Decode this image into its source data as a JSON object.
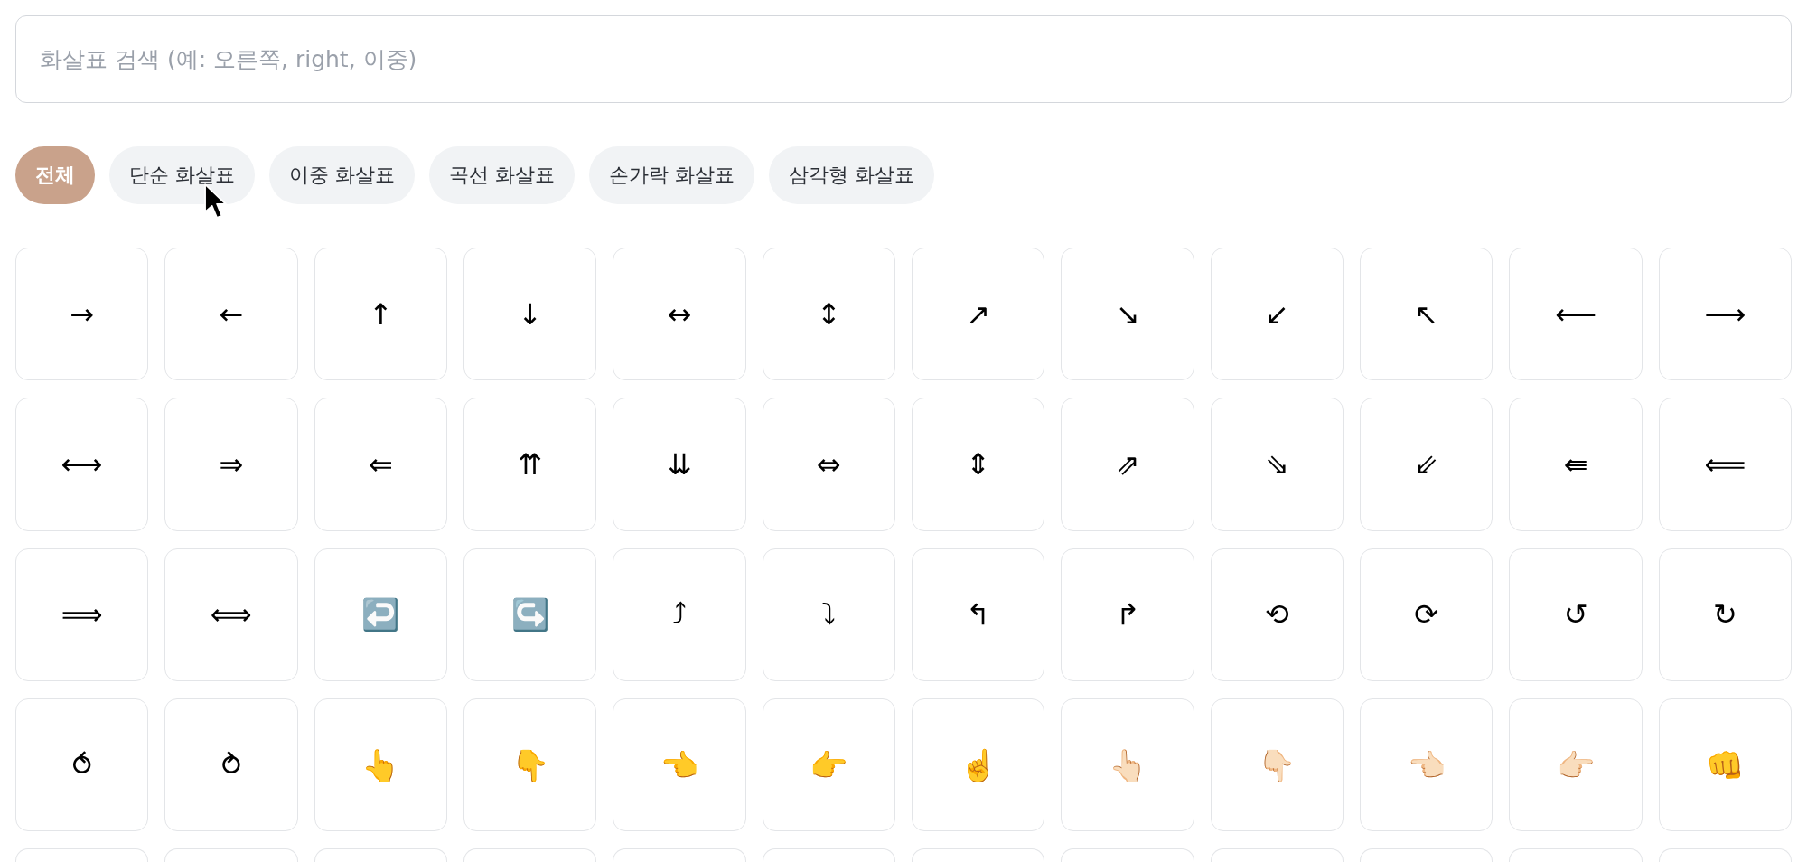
{
  "search": {
    "placeholder": "화살표 검색 (예: 오른쪽, right, 이중)"
  },
  "filters": [
    {
      "label": "전체",
      "selected": true
    },
    {
      "label": "단순 화살표",
      "selected": false
    },
    {
      "label": "이중 화살표",
      "selected": false
    },
    {
      "label": "곡선 화살표",
      "selected": false
    },
    {
      "label": "손가락 화살표",
      "selected": false
    },
    {
      "label": "삼각형 화살표",
      "selected": false
    }
  ],
  "symbols": [
    {
      "kind": "glyph",
      "symbol": "→"
    },
    {
      "kind": "glyph",
      "symbol": "←"
    },
    {
      "kind": "glyph",
      "symbol": "↑"
    },
    {
      "kind": "glyph",
      "symbol": "↓"
    },
    {
      "kind": "glyph",
      "symbol": "↔"
    },
    {
      "kind": "glyph",
      "symbol": "↕"
    },
    {
      "kind": "glyph",
      "symbol": "↗"
    },
    {
      "kind": "glyph",
      "symbol": "↘"
    },
    {
      "kind": "glyph",
      "symbol": "↙"
    },
    {
      "kind": "glyph",
      "symbol": "↖"
    },
    {
      "kind": "glyph",
      "symbol": "⟵"
    },
    {
      "kind": "glyph",
      "symbol": "⟶"
    },
    {
      "kind": "glyph",
      "symbol": "⟷"
    },
    {
      "kind": "glyph",
      "symbol": "⇒"
    },
    {
      "kind": "glyph",
      "symbol": "⇐"
    },
    {
      "kind": "glyph",
      "symbol": "⇈"
    },
    {
      "kind": "glyph",
      "symbol": "⇊"
    },
    {
      "kind": "glyph",
      "symbol": "⇔"
    },
    {
      "kind": "glyph",
      "symbol": "⇕"
    },
    {
      "kind": "glyph",
      "symbol": "⇗"
    },
    {
      "kind": "glyph",
      "symbol": "⇘"
    },
    {
      "kind": "glyph",
      "symbol": "⇙"
    },
    {
      "kind": "glyph",
      "symbol": "⇚"
    },
    {
      "kind": "glyph",
      "symbol": "⟸"
    },
    {
      "kind": "glyph",
      "symbol": "⟹"
    },
    {
      "kind": "glyph",
      "symbol": "⟺"
    },
    {
      "kind": "emoji",
      "symbol": "↩️"
    },
    {
      "kind": "emoji",
      "symbol": "↪️"
    },
    {
      "kind": "glyph",
      "symbol": "⤴"
    },
    {
      "kind": "glyph",
      "symbol": "⤵"
    },
    {
      "kind": "glyph",
      "symbol": "↰"
    },
    {
      "kind": "glyph",
      "symbol": "↱"
    },
    {
      "kind": "glyph",
      "symbol": "⟲"
    },
    {
      "kind": "glyph",
      "symbol": "⟳"
    },
    {
      "kind": "glyph",
      "symbol": "↺"
    },
    {
      "kind": "glyph",
      "symbol": "↻"
    },
    {
      "kind": "glyph",
      "symbol": "⥀"
    },
    {
      "kind": "glyph",
      "symbol": "⥁"
    },
    {
      "kind": "emoji",
      "symbol": "👆"
    },
    {
      "kind": "emoji",
      "symbol": "👇"
    },
    {
      "kind": "emoji",
      "symbol": "👈"
    },
    {
      "kind": "emoji",
      "symbol": "👉"
    },
    {
      "kind": "emoji",
      "symbol": "☝️"
    },
    {
      "kind": "emoji",
      "symbol": "👆🏻"
    },
    {
      "kind": "emoji",
      "symbol": "👇🏻"
    },
    {
      "kind": "emoji",
      "symbol": "👈🏻"
    },
    {
      "kind": "emoji",
      "symbol": "👉🏻"
    },
    {
      "kind": "emoji",
      "symbol": "👊"
    },
    {
      "kind": "cut_off"
    },
    {
      "kind": "cut_off"
    },
    {
      "kind": "cut_off"
    },
    {
      "kind": "cut_off"
    },
    {
      "kind": "cut_off"
    },
    {
      "kind": "cut_off"
    },
    {
      "kind": "cut_off"
    },
    {
      "kind": "cut_off"
    },
    {
      "kind": "cut_off"
    },
    {
      "kind": "cut_off"
    },
    {
      "kind": "cut_off"
    },
    {
      "kind": "cut_off"
    }
  ]
}
